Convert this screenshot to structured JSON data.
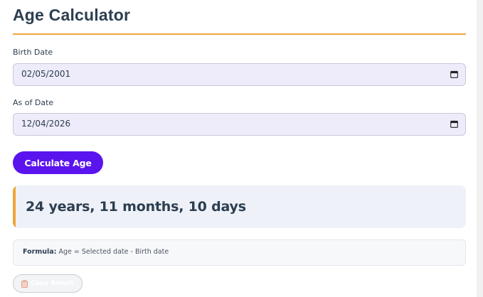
{
  "app": {
    "title": "Age Calculator"
  },
  "birth": {
    "label": "Birth Date",
    "value": "02/05/2001"
  },
  "as_of": {
    "label": "As of Date",
    "value": "12/04/2026"
  },
  "actions": {
    "calculate_label": "Calculate Age",
    "copy_label": "Copy Result"
  },
  "result": {
    "text": "24 years, 11 months, 10 days"
  },
  "formula": {
    "label": "Formula:",
    "text": "Age = Selected date - Birth date"
  },
  "icons": {
    "calendar": "calendar-icon",
    "copy": "clipboard-icon"
  },
  "colors": {
    "accent": "#f0a43a",
    "primary_button": "#5a14ee",
    "title": "#2c3e50",
    "input_bg": "#eeecfb"
  }
}
